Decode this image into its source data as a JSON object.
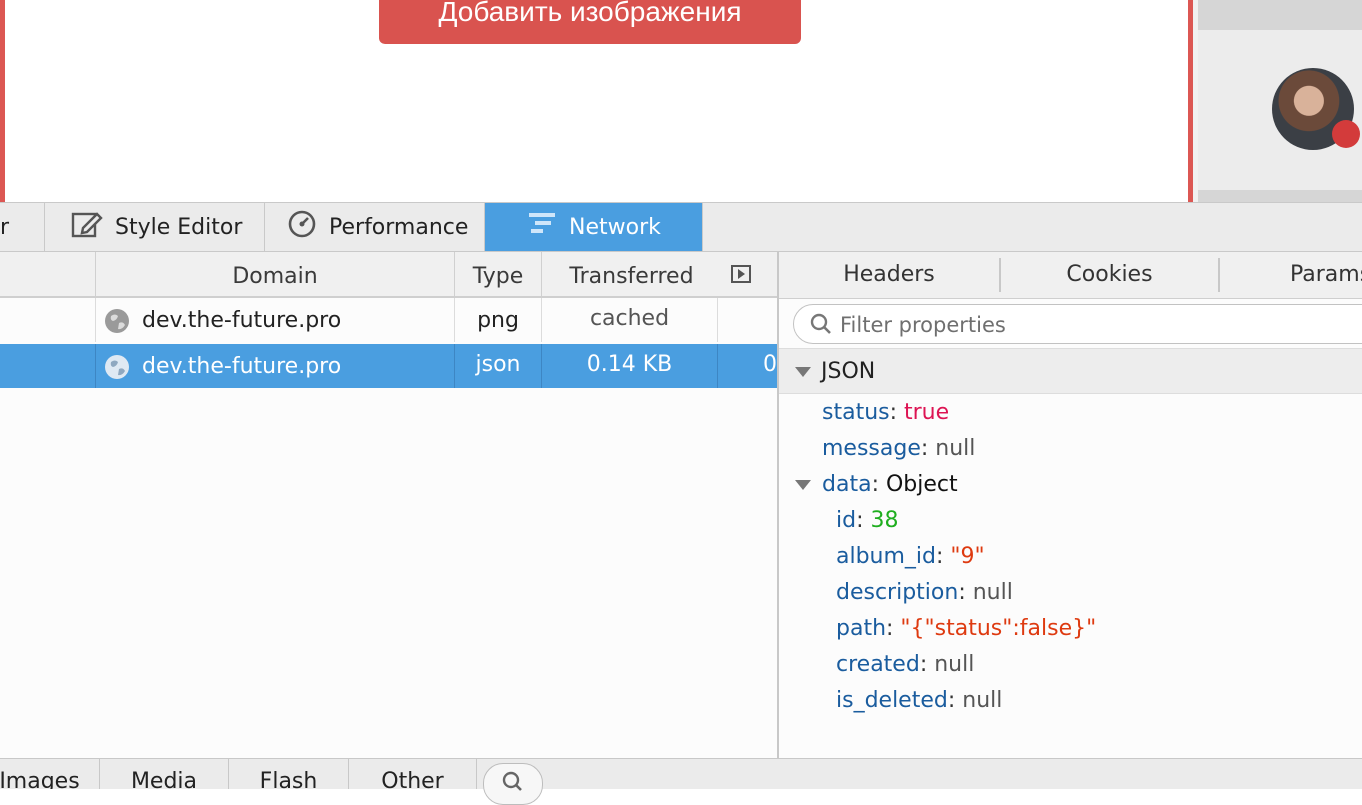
{
  "webpage": {
    "add_images_button": "Добавить изображения"
  },
  "devtools": {
    "tools": [
      {
        "label": "r",
        "icon": "inspector-icon"
      },
      {
        "label": "Style Editor",
        "icon": "style-editor-icon"
      },
      {
        "label": "Performance",
        "icon": "performance-icon"
      },
      {
        "label": "Network",
        "icon": "network-icon",
        "active": true
      }
    ],
    "request_list": {
      "columns": [
        "Domain",
        "Type",
        "Transferred"
      ],
      "rows": [
        {
          "domain": "dev.the-future.pro",
          "type": "png",
          "transferred": "cached",
          "size": ""
        },
        {
          "domain": "dev.the-future.pro",
          "type": "json",
          "transferred": "0.14 KB",
          "size": "0",
          "selected": true
        }
      ]
    },
    "details": {
      "tabs": [
        "Headers",
        "Cookies",
        "Params"
      ],
      "filter_placeholder": "Filter properties",
      "section_title": "JSON",
      "json": {
        "status": {
          "key": "status",
          "value": "true"
        },
        "message": {
          "key": "message",
          "value": "null"
        },
        "data": {
          "key": "data",
          "value": "Object"
        },
        "id": {
          "key": "id",
          "value": "38"
        },
        "album_id": {
          "key": "album_id",
          "value": "\"9\""
        },
        "description": {
          "key": "description",
          "value": "null"
        },
        "path": {
          "key": "path",
          "value": "\"{\"status\":false}\""
        },
        "created": {
          "key": "created",
          "value": "null"
        },
        "is_deleted": {
          "key": "is_deleted",
          "value": "null"
        }
      }
    },
    "filter_bar": [
      "Images",
      "Media",
      "Flash",
      "Other"
    ]
  },
  "colors": {
    "accent": "#4a9ee0",
    "button_red": "#d9534f"
  }
}
